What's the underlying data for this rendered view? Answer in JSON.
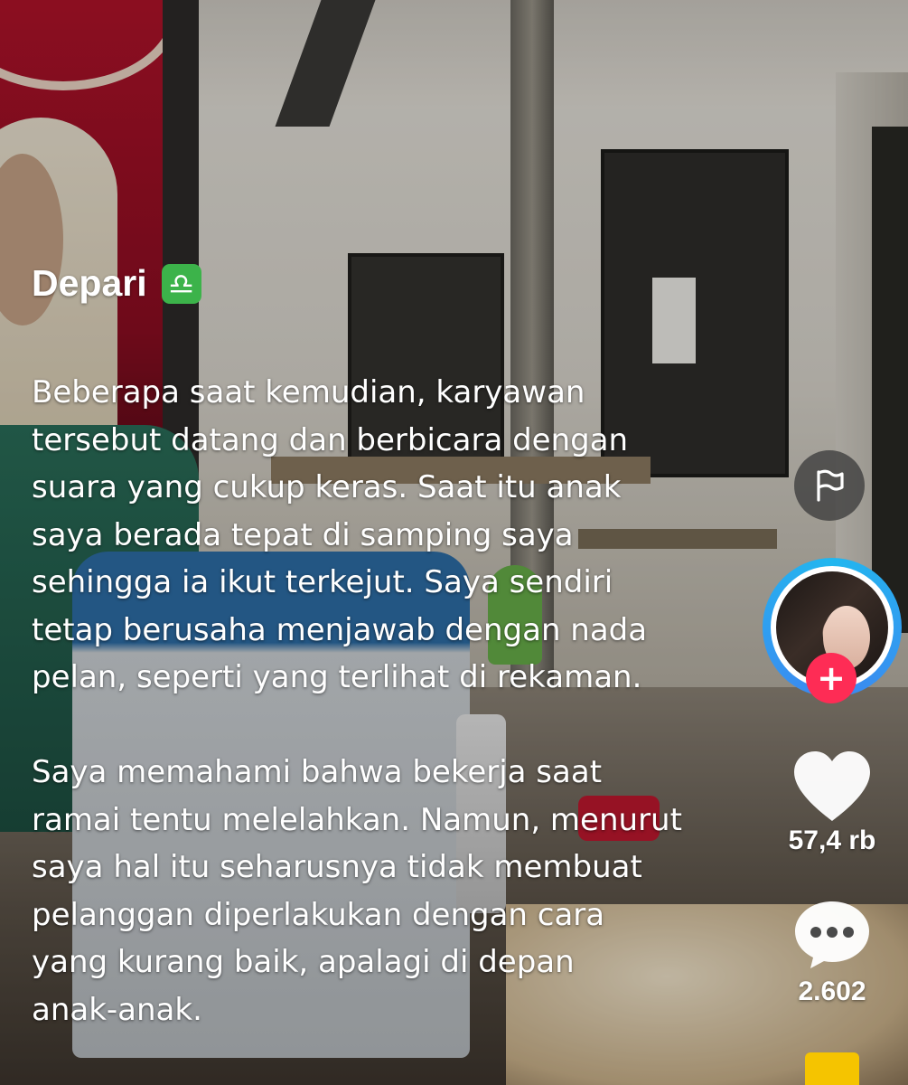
{
  "post": {
    "username": "Depari",
    "zodiac_symbol": "♎",
    "caption_paragraphs": [
      "Beberapa saat kemudian, karyawan\ntersebut datang dan berbicara dengan\nsuara yang cukup keras. Saat itu anak\nsaya berada tepat di samping saya\nsehingga ia ikut terkejut. Saya sendiri\ntetap berusaha menjawab dengan nada\npelan, seperti yang terlihat di rekaman.",
      "Saya memahami bahwa bekerja saat\nramai tentu melelahkan. Namun, menurut\nsaya hal itu seharusnya tidak membuat\npelanggan diperlakukan dengan cara\nyang kurang baik, apalagi di depan\nanak-anak."
    ]
  },
  "actions": {
    "follow_symbol": "+",
    "like_count": "57,4 rb",
    "comment_count": "2.602"
  },
  "icons": {
    "zodiac_badge": "libra-zodiac-icon",
    "report": "flag-icon",
    "like": "heart-icon",
    "comment": "comment-bubble-icon",
    "share": "share-icon"
  },
  "colors": {
    "follow_accent": "#fe2c55",
    "avatar_ring": "#22b7ef",
    "zodiac_badge": "#3cb34a",
    "share_peek": "#f5c400"
  }
}
